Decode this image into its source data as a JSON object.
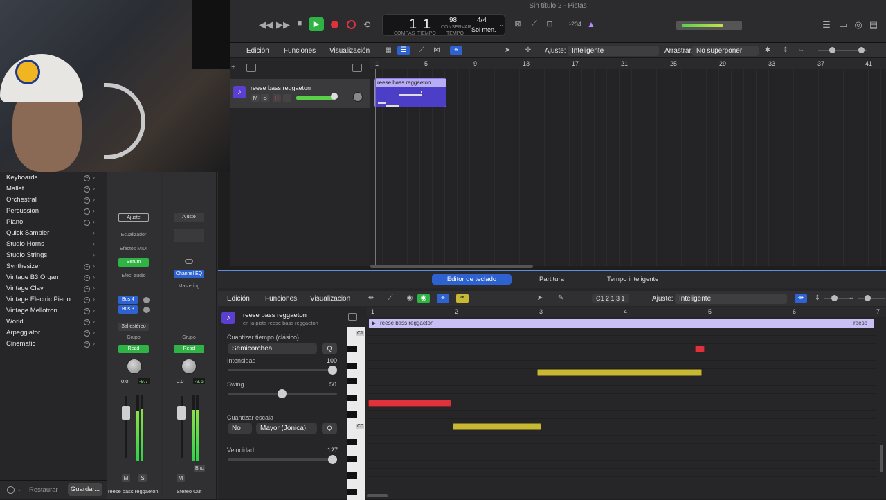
{
  "window": {
    "title": "Sin título 2 - Pistas"
  },
  "transport": {
    "bar": "1",
    "beat": "1",
    "bar_caption": "COMPÁS",
    "beat_caption": "TIEMPO",
    "tempo": "98",
    "tempo_caption": "CONSERVAR",
    "tempo_caption2": "TEMPO",
    "signature": "4/4",
    "key": "Sol men.",
    "count_in": "¹234"
  },
  "tracks_menu": {
    "edit": "Edición",
    "functions": "Funciones",
    "view": "Visualización",
    "snap_label": "Ajuste:",
    "snap_value": "Inteligente",
    "drag_label": "Arrastrar:",
    "drag_value": "No superponer"
  },
  "ruler": {
    "marks": [
      "1",
      "5",
      "9",
      "13",
      "17",
      "21",
      "25",
      "29",
      "33",
      "37",
      "41"
    ]
  },
  "track": {
    "name": "reese bass reggaeton",
    "mute": "M",
    "solo": "S",
    "record": "R",
    "region_name": "reese bass reggaeton"
  },
  "library": {
    "items": [
      {
        "label": "Keyboards",
        "plus": true
      },
      {
        "label": "Mallet",
        "plus": true
      },
      {
        "label": "Orchestral",
        "plus": true
      },
      {
        "label": "Percussion",
        "plus": true
      },
      {
        "label": "Piano",
        "plus": true
      },
      {
        "label": "Quick Sampler",
        "plus": false
      },
      {
        "label": "Studio Horns",
        "plus": false
      },
      {
        "label": "Studio Strings",
        "plus": false
      },
      {
        "label": "Synthesizer",
        "plus": true
      },
      {
        "label": "Vintage B3 Organ",
        "plus": true
      },
      {
        "label": "Vintage Clav",
        "plus": true
      },
      {
        "label": "Vintage Electric Piano",
        "plus": true
      },
      {
        "label": "Vintage Mellotron",
        "plus": true
      },
      {
        "label": "World",
        "plus": true
      },
      {
        "label": "Arpeggiator",
        "plus": true
      },
      {
        "label": "Cinematic",
        "plus": true
      }
    ],
    "restore": "Restaurar",
    "save": "Guardar..."
  },
  "mixer": {
    "strip1": {
      "settings": "Ajuste",
      "eq": "Ecualizador",
      "midi_fx": "Efectos MIDI",
      "instrument": "Serum",
      "audio_fx": "Efec. audio",
      "send1": "Bus 4",
      "send2": "Bus 3",
      "output": "Sal estéreo",
      "group": "Grupo",
      "automation": "Read",
      "volume": "0.0",
      "peak": "-9.7",
      "mute": "M",
      "solo": "S",
      "name": "reese bass reggaeton"
    },
    "strip2": {
      "settings": "Ajuste",
      "plugin": "Channel EQ",
      "plugin2": "Mastering",
      "group": "Grupo",
      "automation": "Read",
      "volume": "0.0",
      "peak": "-9.6",
      "mute": "M",
      "bounce": "Bnc",
      "name": "Stereo Out"
    }
  },
  "editor": {
    "tabs": [
      "Editor de teclado",
      "Partitura",
      "Tempo inteligente"
    ],
    "edit": "Edición",
    "functions": "Funciones",
    "view": "Visualización",
    "position": "C1  2 1 3 1",
    "snap_label": "Ajuste:",
    "snap_value": "Inteligente",
    "region_title": "reese bass reggaeton",
    "region_subtitle": "en la pista reese bass reggaeton",
    "quantize_label": "Cuantizar tiempo (clásico)",
    "quantize_value": "Semicorchea",
    "q": "Q",
    "strength_label": "Intensidad",
    "strength_value": "100",
    "swing_label": "Swing",
    "swing_value": "50",
    "scale_label": "Cuantizar escala",
    "scale_no": "No",
    "scale_value": "Mayor (Jónica)",
    "velocity_label": "Velocidad",
    "velocity_value": "127",
    "ruler": [
      "1",
      "2",
      "3",
      "4",
      "5",
      "6",
      "7"
    ],
    "region_strip": "reese bass reggaeton",
    "region_strip_end": "reese",
    "key_labels": [
      "C1",
      "C0"
    ]
  },
  "colors": {
    "accent": "#2d62d0",
    "region": "#4c3ec7",
    "note_red": "#e0323c",
    "note_yellow": "#c9b834",
    "meter": "#5ad04a"
  }
}
